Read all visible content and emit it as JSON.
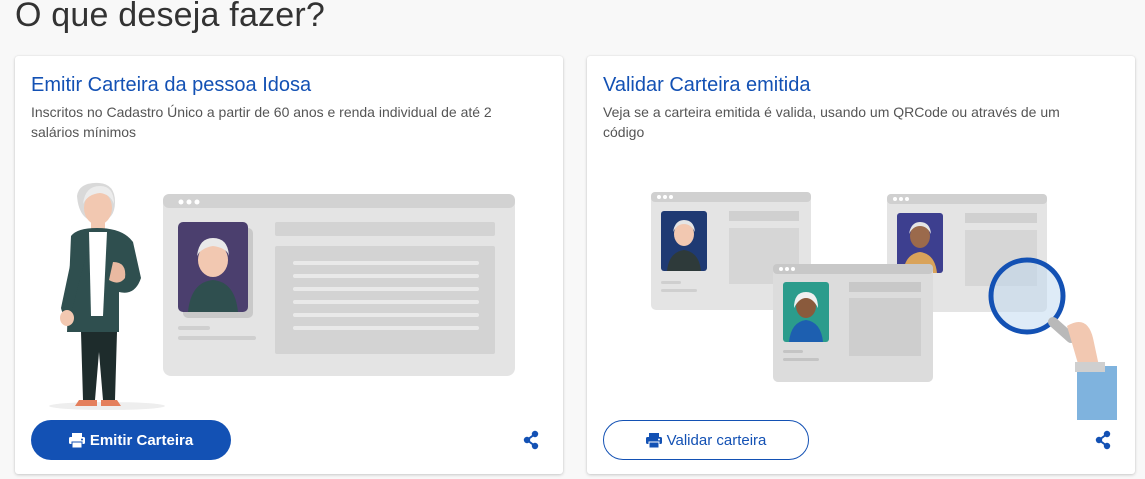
{
  "page": {
    "heading": "O que deseja fazer?"
  },
  "cards": [
    {
      "title": "Emitir Carteira da pessoa Idosa",
      "description": "Inscritos no Cadastro Único a partir de 60 anos e renda individual de até 2 salários mínimos",
      "button_label": "Emitir Carteira",
      "button_icon": "printer-icon",
      "share_icon": "share-icon"
    },
    {
      "title": "Validar Carteira emitida",
      "description": "Veja se a carteira emitida é valida, usando um QRCode ou através de um código",
      "button_label": "Validar carteira",
      "button_icon": "printer-icon",
      "share_icon": "share-icon"
    }
  ],
  "colors": {
    "primary": "#1351b4",
    "text": "#555555",
    "heading": "#333333"
  }
}
